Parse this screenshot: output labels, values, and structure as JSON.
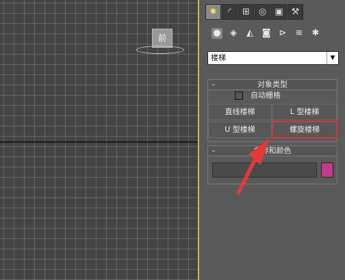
{
  "tabs": [
    {
      "name": "create-tab",
      "icon": "sun-icon",
      "glyph": "✸"
    },
    {
      "name": "modify-tab",
      "icon": "curve-icon",
      "glyph": "◜"
    },
    {
      "name": "hierarchy-tab",
      "icon": "hierarchy-icon",
      "glyph": "⊞"
    },
    {
      "name": "motion-tab",
      "icon": "motion-icon",
      "glyph": "◎"
    },
    {
      "name": "display-tab",
      "icon": "monitor-icon",
      "glyph": "▣"
    },
    {
      "name": "utilities-tab",
      "icon": "hammer-icon",
      "glyph": "⚒"
    }
  ],
  "categories": [
    {
      "name": "geometry",
      "icon": "sphere-icon",
      "glyph": "●"
    },
    {
      "name": "shapes",
      "icon": "shapes-icon",
      "glyph": "◈"
    },
    {
      "name": "lights",
      "icon": "light-icon",
      "glyph": "◭"
    },
    {
      "name": "cameras",
      "icon": "camera-icon",
      "glyph": "◙"
    },
    {
      "name": "helpers",
      "icon": "helper-icon",
      "glyph": "⊳"
    },
    {
      "name": "spacewarps",
      "icon": "wave-icon",
      "glyph": "≋"
    },
    {
      "name": "systems",
      "icon": "gear-icon",
      "glyph": "✱"
    }
  ],
  "viewcube_label": "前",
  "dropdown": {
    "value": "楼梯"
  },
  "object_type": {
    "title": "对象类型",
    "autogrid_label": "自动栅格",
    "buttons": [
      "直线楼梯",
      "L 型楼梯",
      "U 型楼梯",
      "螺旋楼梯"
    ]
  },
  "name_color": {
    "title": "名称和颜色"
  },
  "colors": {
    "swatch": "#c53a8a",
    "highlight": "#d8353f",
    "arrow": "#e23a3a"
  }
}
